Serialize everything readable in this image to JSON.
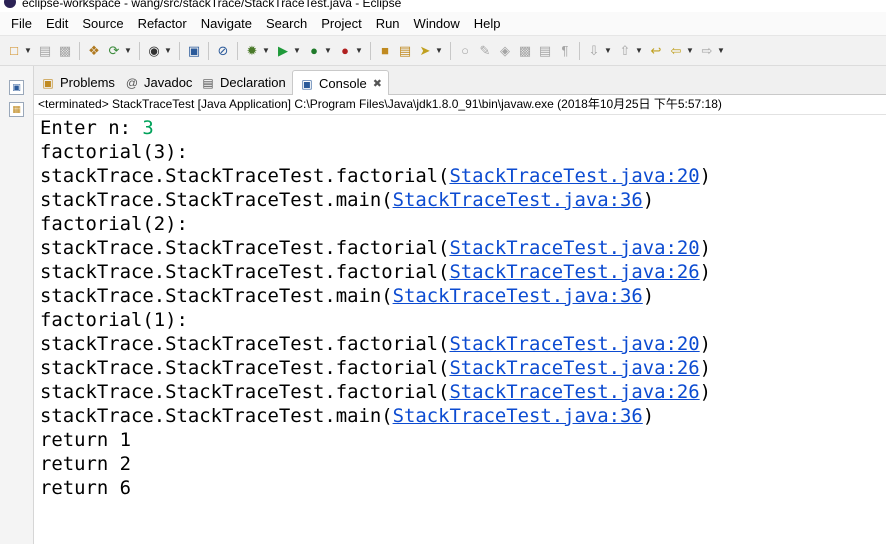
{
  "window": {
    "title": "eclipse-workspace - wang/src/stackTrace/StackTraceTest.java - Eclipse"
  },
  "menu": [
    "File",
    "Edit",
    "Source",
    "Refactor",
    "Navigate",
    "Search",
    "Project",
    "Run",
    "Window",
    "Help"
  ],
  "tabs": [
    {
      "label": "Problems",
      "icon": "problems-icon"
    },
    {
      "label": "Javadoc",
      "icon": "javadoc-icon"
    },
    {
      "label": "Declaration",
      "icon": "declaration-icon"
    },
    {
      "label": "Console",
      "icon": "console-icon",
      "active": true
    }
  ],
  "console": {
    "status": "<terminated> StackTraceTest [Java Application] C:\\Program Files\\Java\\jdk1.8.0_91\\bin\\javaw.exe (2018年10月25日 下午5:57:18)",
    "lines": [
      {
        "text": "Enter n: ",
        "input": "3"
      },
      {
        "text": "factorial(3):"
      },
      {
        "text": "stackTrace.StackTraceTest.factorial(",
        "link": "StackTraceTest.java:20",
        "suffix": ")"
      },
      {
        "text": "stackTrace.StackTraceTest.main(",
        "link": "StackTraceTest.java:36",
        "suffix": ")"
      },
      {
        "text": "factorial(2):"
      },
      {
        "text": "stackTrace.StackTraceTest.factorial(",
        "link": "StackTraceTest.java:20",
        "suffix": ")"
      },
      {
        "text": "stackTrace.StackTraceTest.factorial(",
        "link": "StackTraceTest.java:26",
        "suffix": ")"
      },
      {
        "text": "stackTrace.StackTraceTest.main(",
        "link": "StackTraceTest.java:36",
        "suffix": ")"
      },
      {
        "text": "factorial(1):"
      },
      {
        "text": "stackTrace.StackTraceTest.factorial(",
        "link": "StackTraceTest.java:20",
        "suffix": ")"
      },
      {
        "text": "stackTrace.StackTraceTest.factorial(",
        "link": "StackTraceTest.java:26",
        "suffix": ")"
      },
      {
        "text": "stackTrace.StackTraceTest.factorial(",
        "link": "StackTraceTest.java:26",
        "suffix": ")"
      },
      {
        "text": "stackTrace.StackTraceTest.main(",
        "link": "StackTraceTest.java:36",
        "suffix": ")"
      },
      {
        "text": "return 1"
      },
      {
        "text": "return 2"
      },
      {
        "text": "return 6"
      }
    ]
  },
  "colors": {
    "link": "#0c4bd1",
    "user_input": "#00a25a",
    "toolbar_bg": "#f2f2f2"
  }
}
